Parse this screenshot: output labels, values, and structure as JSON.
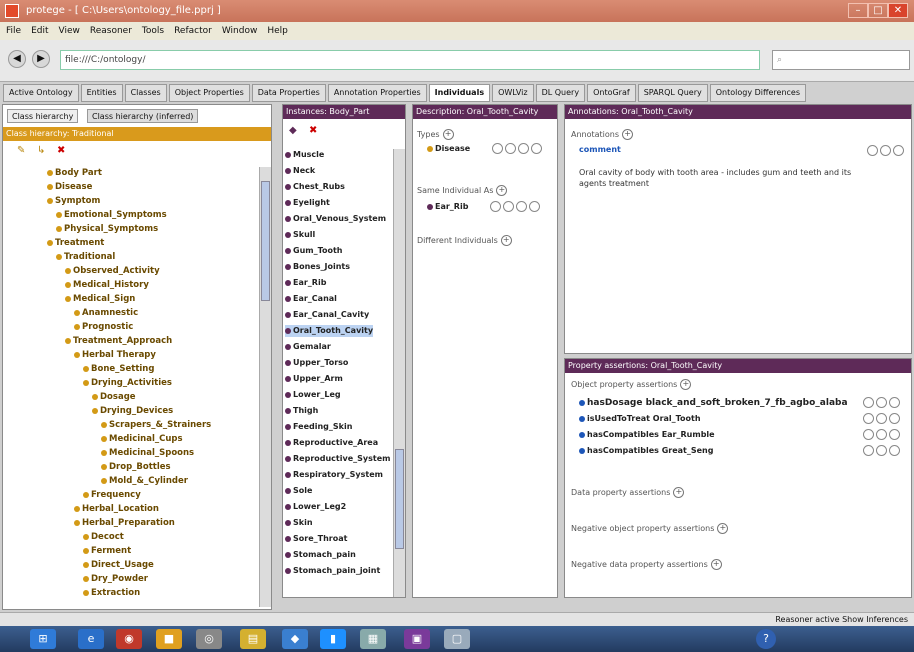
{
  "window": {
    "title": "protege - [ C:\\Users\\ontology_file.pprj ]"
  },
  "menu": [
    "File",
    "Edit",
    "View",
    "Reasoner",
    "Tools",
    "Refactor",
    "Window",
    "Help"
  ],
  "address": {
    "url": "file:///C:/ontology/"
  },
  "tabs": [
    {
      "label": "Active Ontology",
      "active": false
    },
    {
      "label": "Entities",
      "active": false
    },
    {
      "label": "Classes",
      "active": false
    },
    {
      "label": "Object Properties",
      "active": false
    },
    {
      "label": "Data Properties",
      "active": false
    },
    {
      "label": "Annotation Properties",
      "active": false
    },
    {
      "label": "Individuals",
      "active": true
    },
    {
      "label": "OWLViz",
      "active": false
    },
    {
      "label": "DL Query",
      "active": false
    },
    {
      "label": "OntoGraf",
      "active": false
    },
    {
      "label": "SPARQL Query",
      "active": false
    },
    {
      "label": "Ontology Differences",
      "active": false
    }
  ],
  "class_panel": {
    "subtab_1": "Class hierarchy",
    "subtab_2": "Class hierarchy (inferred)",
    "header": "Class hierarchy: Traditional",
    "items": [
      {
        "label": "Body Part",
        "indent": 0
      },
      {
        "label": "Disease",
        "indent": 0
      },
      {
        "label": "Symptom",
        "indent": 0
      },
      {
        "label": "Emotional_Symptoms",
        "indent": 1
      },
      {
        "label": "Physical_Symptoms",
        "indent": 1
      },
      {
        "label": "Treatment",
        "indent": 0
      },
      {
        "label": "Traditional",
        "indent": 1
      },
      {
        "label": "Observed_Activity",
        "indent": 2
      },
      {
        "label": "Medical_History",
        "indent": 2
      },
      {
        "label": "Medical_Sign",
        "indent": 2
      },
      {
        "label": "Anamnestic",
        "indent": 3
      },
      {
        "label": "Prognostic",
        "indent": 3
      },
      {
        "label": "Treatment_Approach",
        "indent": 2
      },
      {
        "label": "Herbal Therapy",
        "indent": 3
      },
      {
        "label": "Bone_Setting",
        "indent": 4
      },
      {
        "label": "Drying_Activities",
        "indent": 4
      },
      {
        "label": "Dosage",
        "indent": 5
      },
      {
        "label": "Drying_Devices",
        "indent": 5
      },
      {
        "label": "Scrapers_&_Strainers",
        "indent": 6
      },
      {
        "label": "Medicinal_Cups",
        "indent": 6
      },
      {
        "label": "Medicinal_Spoons",
        "indent": 6
      },
      {
        "label": "Drop_Bottles",
        "indent": 6
      },
      {
        "label": "Mold_&_Cylinder",
        "indent": 6
      },
      {
        "label": "Frequency",
        "indent": 4
      },
      {
        "label": "Herbal_Location",
        "indent": 3
      },
      {
        "label": "Herbal_Preparation",
        "indent": 3
      },
      {
        "label": "Decoct",
        "indent": 4
      },
      {
        "label": "Ferment",
        "indent": 4
      },
      {
        "label": "Direct_Usage",
        "indent": 4
      },
      {
        "label": "Dry_Powder",
        "indent": 4
      },
      {
        "label": "Extraction",
        "indent": 4
      }
    ]
  },
  "instances_panel": {
    "header": "Instances: Body_Part",
    "items": [
      "Muscle",
      "Neck",
      "Chest_Rubs",
      "Eyelight",
      "Oral_Venous_System",
      "Skull",
      "Gum_Tooth",
      "Bones_Joints",
      "Ear_Rib",
      "Ear_Canal",
      "Ear_Canal_Cavity",
      "Oral_Tooth_Cavity",
      "Gemalar",
      "Upper_Torso",
      "Upper_Arm",
      "Lower_Leg",
      "Thigh",
      "Feeding_Skin",
      "Reproductive_Area",
      "Reproductive_System",
      "Respiratory_System",
      "Sole",
      "Lower_Leg2",
      "Skin",
      "Sore_Throat",
      "Stomach_pain",
      "Stomach_pain_joint"
    ],
    "selected_index": 11
  },
  "types_panel": {
    "header": "Description: Oral_Tooth_Cavity",
    "types_label": "Types",
    "types": [
      "Disease"
    ],
    "same_label": "Same Individual As",
    "same": [
      "Ear_Rib"
    ],
    "different_label": "Different Individuals"
  },
  "annotations_panel": {
    "header": "Annotations: Oral_Tooth_Cavity",
    "section": "Annotations",
    "annotation_label": "comment",
    "annotation_text": "Oral cavity of body with tooth area - includes gum and teeth and its agents treatment"
  },
  "property_panel": {
    "header": "Property assertions: Oral_Tooth_Cavity",
    "object_label": "Object property assertions",
    "assertions": [
      "hasDosage  black_and_soft_broken_7_fb_agbo_alaba",
      "isUsedToTreat  Oral_Tooth",
      "hasCompatibles  Ear_Rumble",
      "hasCompatibles  Great_Seng"
    ],
    "data_label": "Data property assertions",
    "neg_obj_label": "Negative object property assertions",
    "neg_data_label": "Negative data property assertions"
  },
  "status": {
    "text": "Reasoner active   Show Inferences"
  },
  "colors": {
    "title": "#c8735a",
    "header": "#5e2a58",
    "class": "#d39a16",
    "selection": "#bcd3f2"
  }
}
